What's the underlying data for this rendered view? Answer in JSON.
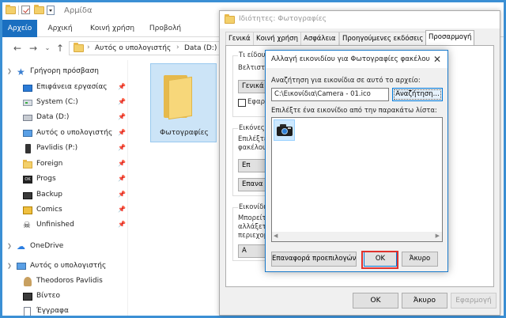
{
  "explorer": {
    "window_title": "Αρμίδα",
    "ribbon_tabs": [
      "Αρχείο",
      "Αρχική",
      "Κοινή χρήση",
      "Προβολή"
    ],
    "address": {
      "parts": [
        "Αυτός ο υπολογιστής",
        "Data (D:)"
      ]
    },
    "nav_items": [
      {
        "label": "Γρήγορη πρόσβαση",
        "icon": "star-icon"
      },
      {
        "label": "Επιφάνεια εργασίας",
        "icon": "desktop-icon",
        "pinned": true
      },
      {
        "label": "System (C:)",
        "icon": "drive-icon",
        "pinned": true
      },
      {
        "label": "Data (D:)",
        "icon": "disk-icon",
        "pinned": true
      },
      {
        "label": "Αυτός ο υπολογιστής",
        "icon": "computer-icon",
        "pinned": true
      },
      {
        "label": "Pavlidis (P:)",
        "icon": "phone-icon",
        "pinned": true
      },
      {
        "label": "Foreign",
        "icon": "folder-icon",
        "pinned": true
      },
      {
        "label": "Progs",
        "icon": "progs-icon",
        "pinned": true
      },
      {
        "label": "Backup",
        "icon": "backup-icon",
        "pinned": true
      },
      {
        "label": "Comics",
        "icon": "comics-icon",
        "pinned": true
      },
      {
        "label": "Unfinished",
        "icon": "pirate-icon",
        "pinned": true
      },
      {
        "label": "OneDrive",
        "icon": "cloud-icon"
      },
      {
        "label": "Αυτός ο υπολογιστής",
        "icon": "computer-icon"
      },
      {
        "label": "Theodoros Pavlidis",
        "icon": "user-folder-icon"
      },
      {
        "label": "Βίντεο",
        "icon": "video-icon"
      },
      {
        "label": "Έγγραφα",
        "icon": "document-icon"
      }
    ],
    "folder_tile": {
      "label": "Φωτογραφίες"
    }
  },
  "properties": {
    "title": "Ιδιότητες: Φωτογραφίες",
    "tabs": [
      "Γενικά",
      "Κοινή χρήση",
      "Ασφάλεια",
      "Προηγούμενες εκδόσεις",
      "Προσαρμογή"
    ],
    "active_tab": "Προσαρμογή",
    "group1": {
      "label": "Τι είδους",
      "text": "Βελτιστο",
      "dropdown": "Γενικά σ",
      "check_label": "Εφαρ"
    },
    "group2": {
      "label": "Εικόνες φ",
      "line1": "Επιλέξτε",
      "line2": "φακέλου",
      "btn1": "Επ",
      "btn2": "Επανα"
    },
    "group3": {
      "label": "Εικονίδιο",
      "line1": "Μπορείτ",
      "line2": "αλλάξετ",
      "line3": "περιεχομ",
      "btn": "Α"
    },
    "buttons": {
      "ok": "OK",
      "cancel": "Άκυρο",
      "apply": "Εφαρμογή"
    }
  },
  "change_icon": {
    "title": "Αλλαγή εικονιδίου για Φωτογραφίες φακέλου",
    "close": "✕",
    "search_label": "Αναζήτηση για εικονίδια σε αυτό το αρχείο:",
    "path_value": "C:\\Εικονίδια\\Camera - 01.ico",
    "browse_label": "Αναζήτηση...",
    "list_label": "Επιλέξτε ένα εικονίδιο από την παρακάτω λίστα:",
    "selected_icon": "camera-icon",
    "buttons": {
      "restore": "Επαναφορά προεπιλογών",
      "ok": "OK",
      "cancel": "Άκυρο"
    },
    "highlight_color": "#e0312c"
  }
}
